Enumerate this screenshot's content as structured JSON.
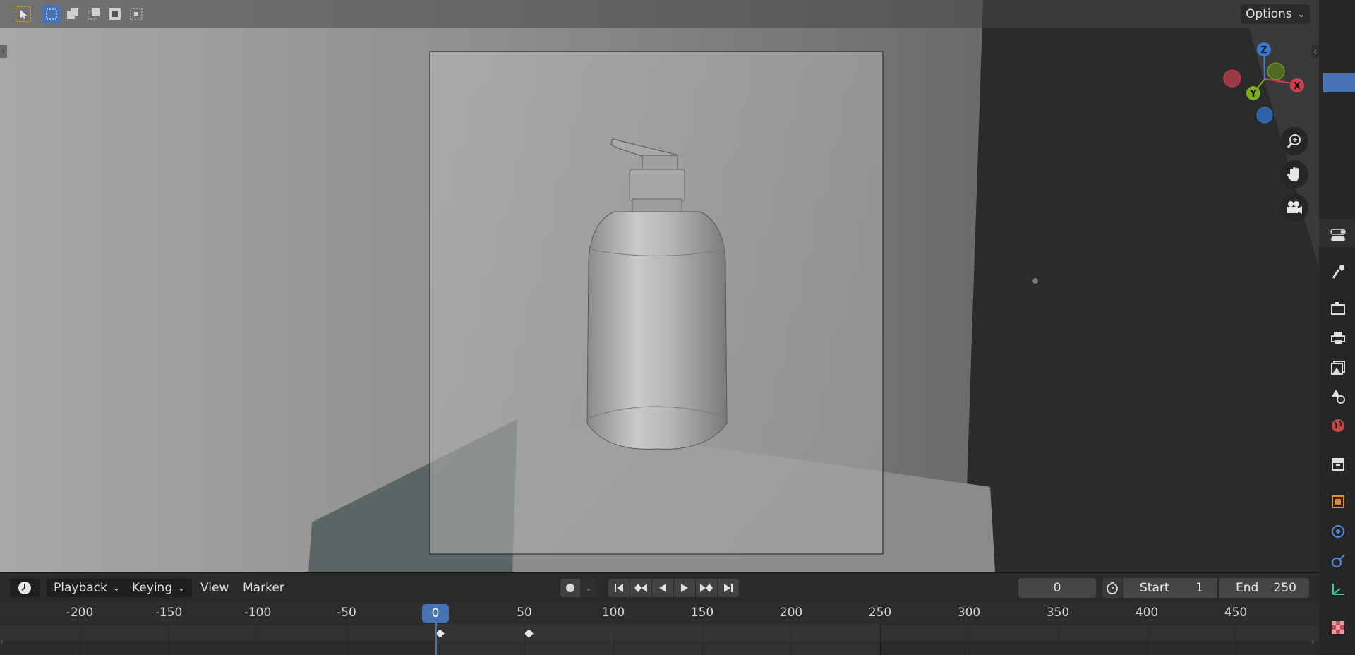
{
  "viewport": {
    "options_label": "Options",
    "gizmo": {
      "z_label": "Z",
      "y_label": "Y",
      "x_label": "X"
    }
  },
  "timeline": {
    "menus": {
      "editor_icon": "clock-icon",
      "playback": "Playback",
      "keying": "Keying",
      "view": "View",
      "marker": "Marker"
    },
    "current_frame": "0",
    "start_label": "Start",
    "start_value": "1",
    "end_label": "End",
    "end_value": "250",
    "ruler_ticks": [
      "-200",
      "-150",
      "-100",
      "-50",
      "0",
      "50",
      "100",
      "150",
      "200",
      "250",
      "300",
      "350",
      "400",
      "450"
    ],
    "playhead_label": "0",
    "keyframes": [
      "0",
      "50"
    ]
  },
  "properties_tabs": [
    "tool",
    "render",
    "output",
    "view-layer",
    "scene",
    "world",
    "collection",
    "object",
    "modifiers",
    "physics",
    "constraints",
    "texture"
  ],
  "colors": {
    "accent": "#4772b3",
    "x_axis": "#d33b4f",
    "y_axis": "#7bab1e",
    "z_axis": "#3a79d1",
    "active_tab": "#4772b3"
  }
}
